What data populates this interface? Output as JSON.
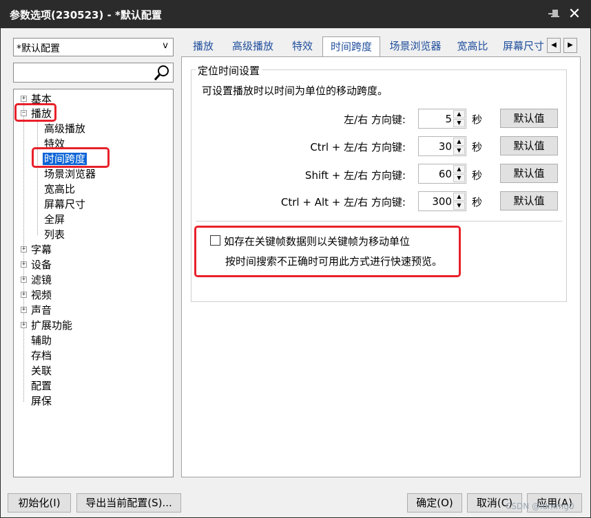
{
  "window": {
    "title": "参数选项(230523) - *默认配置",
    "close_glyph": "✕"
  },
  "preset": {
    "value": "*默认配置",
    "arrow": "v"
  },
  "search": {
    "value": ""
  },
  "tree": [
    {
      "label": "基本",
      "expander": "+"
    },
    {
      "label": "播放",
      "expander": "−"
    },
    {
      "label": "高级播放"
    },
    {
      "label": "特效"
    },
    {
      "label": "时间跨度"
    },
    {
      "label": "场景浏览器"
    },
    {
      "label": "宽高比"
    },
    {
      "label": "屏幕尺寸"
    },
    {
      "label": "全屏"
    },
    {
      "label": "列表"
    },
    {
      "label": "字幕",
      "expander": "+"
    },
    {
      "label": "设备",
      "expander": "+"
    },
    {
      "label": "滤镜",
      "expander": "+"
    },
    {
      "label": "视频",
      "expander": "+"
    },
    {
      "label": "声音",
      "expander": "+"
    },
    {
      "label": "扩展功能",
      "expander": "+"
    },
    {
      "label": "辅助"
    },
    {
      "label": "存档"
    },
    {
      "label": "关联"
    },
    {
      "label": "配置"
    },
    {
      "label": "屏保"
    }
  ],
  "tabs": [
    {
      "label": "播放"
    },
    {
      "label": "高级播放"
    },
    {
      "label": "特效"
    },
    {
      "label": "时间跨度"
    },
    {
      "label": "场景浏览器"
    },
    {
      "label": "宽高比"
    },
    {
      "label": "屏幕尺寸"
    }
  ],
  "tab_scroll": {
    "left": "◀",
    "right": "▶"
  },
  "group": {
    "title": "定位时间设置",
    "description": "可设置播放时以时间为单位的移动跨度。",
    "rows": [
      {
        "label": "左/右 方向键:",
        "value": "5",
        "unit": "秒",
        "button": "默认值"
      },
      {
        "label": "Ctrl + 左/右 方向键:",
        "value": "30",
        "unit": "秒",
        "button": "默认值"
      },
      {
        "label": "Shift + 左/右 方向键:",
        "value": "60",
        "unit": "秒",
        "button": "默认值"
      },
      {
        "label": "Ctrl + Alt + 左/右 方向键:",
        "value": "300",
        "unit": "秒",
        "button": "默认值"
      }
    ],
    "spin_up": "▲",
    "spin_down": "▼",
    "checkbox_label": "如存在关键帧数据则以关键帧为移动单位",
    "checkbox_checked": false,
    "checkbox_hint": "按时间搜索不正确时可用此方式进行快速预览。"
  },
  "footer": {
    "init": "初始化(I)",
    "export": "导出当前配置(S)...",
    "ok": "确定(O)",
    "cancel": "取消(C)",
    "apply": "应用(A)"
  },
  "watermark": "CSDN @ldmmg0",
  "colors": {
    "titlebar": "#2b2b2b",
    "selection": "#0a64d6",
    "highlight": "#e8202a",
    "tab_text": "#1f4e9c"
  }
}
